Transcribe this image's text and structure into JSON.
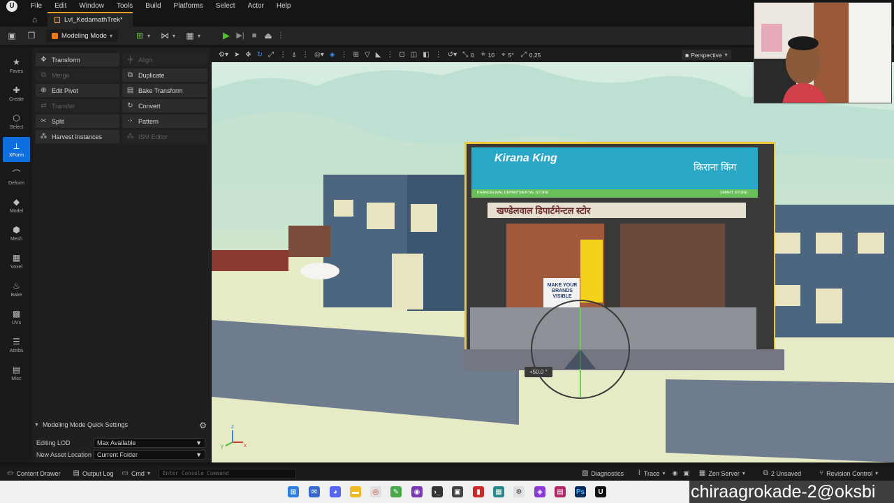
{
  "menu": [
    "File",
    "Edit",
    "Window",
    "Tools",
    "Build",
    "Platforms",
    "Select",
    "Actor",
    "Help"
  ],
  "level_tab": "Lvl_KedarnathTrek*",
  "toolbar": {
    "mode_label": "Modeling Mode"
  },
  "left_strip": [
    {
      "label": "Faves",
      "icon": "star-icon",
      "glyph": "★"
    },
    {
      "label": "Create",
      "icon": "create-icon",
      "glyph": "✚"
    },
    {
      "label": "Select",
      "icon": "select-icon",
      "glyph": "⬡"
    },
    {
      "label": "XForm",
      "icon": "xform-icon",
      "glyph": "⟂",
      "active": true
    },
    {
      "label": "Deform",
      "icon": "deform-icon",
      "glyph": "⌒"
    },
    {
      "label": "Model",
      "icon": "model-icon",
      "glyph": "◆"
    },
    {
      "label": "Mesh",
      "icon": "mesh-icon",
      "glyph": "⬢"
    },
    {
      "label": "Voxel",
      "icon": "voxel-icon",
      "glyph": "▦"
    },
    {
      "label": "Bake",
      "icon": "bake-icon",
      "glyph": "♨"
    },
    {
      "label": "UVs",
      "icon": "uvs-icon",
      "glyph": "▩"
    },
    {
      "label": "Attribs",
      "icon": "attribs-icon",
      "glyph": "☰"
    },
    {
      "label": "Misc",
      "icon": "misc-icon",
      "glyph": "▤"
    }
  ],
  "tools": {
    "transform": "Transform",
    "align": "Align",
    "merge": "Merge",
    "duplicate": "Duplicate",
    "edit_pivot": "Edit Pivot",
    "bake_transform": "Bake Transform",
    "transfer": "Transfer",
    "convert": "Convert",
    "split": "Split",
    "pattern": "Pattern",
    "harvest_instances": "Harvest Instances",
    "ism_editor": "ISM Editor"
  },
  "quick_settings": {
    "title": "Modeling Mode Quick Settings",
    "editing_lod_label": "Editing LOD",
    "editing_lod_value": "Max Available",
    "asset_location_label": "New Asset Location",
    "asset_location_value": "Current Folder"
  },
  "viewport": {
    "snap_translate": "0",
    "snap_grid": "10",
    "snap_rotate": "5°",
    "snap_scale": "0.25",
    "view_mode": "Perspective",
    "rotation_readout": "+50.0 °",
    "shop_sign_left": "Kirana King",
    "shop_sign_right": "किराना किंग",
    "shop_name": "खण्डेलवाल डिपार्टमेन्टल स्टोर",
    "shop_subline_left": "KHANDELWAL DEPARTMENTAL STORE",
    "shop_subline_right": "SMART STORE",
    "banner_text": "MAKE YOUR BRANDS VISIBLE"
  },
  "statusbar": {
    "content_drawer": "Content Drawer",
    "output_log": "Output Log",
    "cmd": "Cmd",
    "console_placeholder": "Enter Console Command",
    "diagnostics": "Diagnostics",
    "trace": "Trace",
    "zen_server": "Zen Server",
    "unsaved": "2 Unsaved",
    "revision_control": "Revision Control"
  },
  "watermark": "chiraagrokade-2@oksbi"
}
